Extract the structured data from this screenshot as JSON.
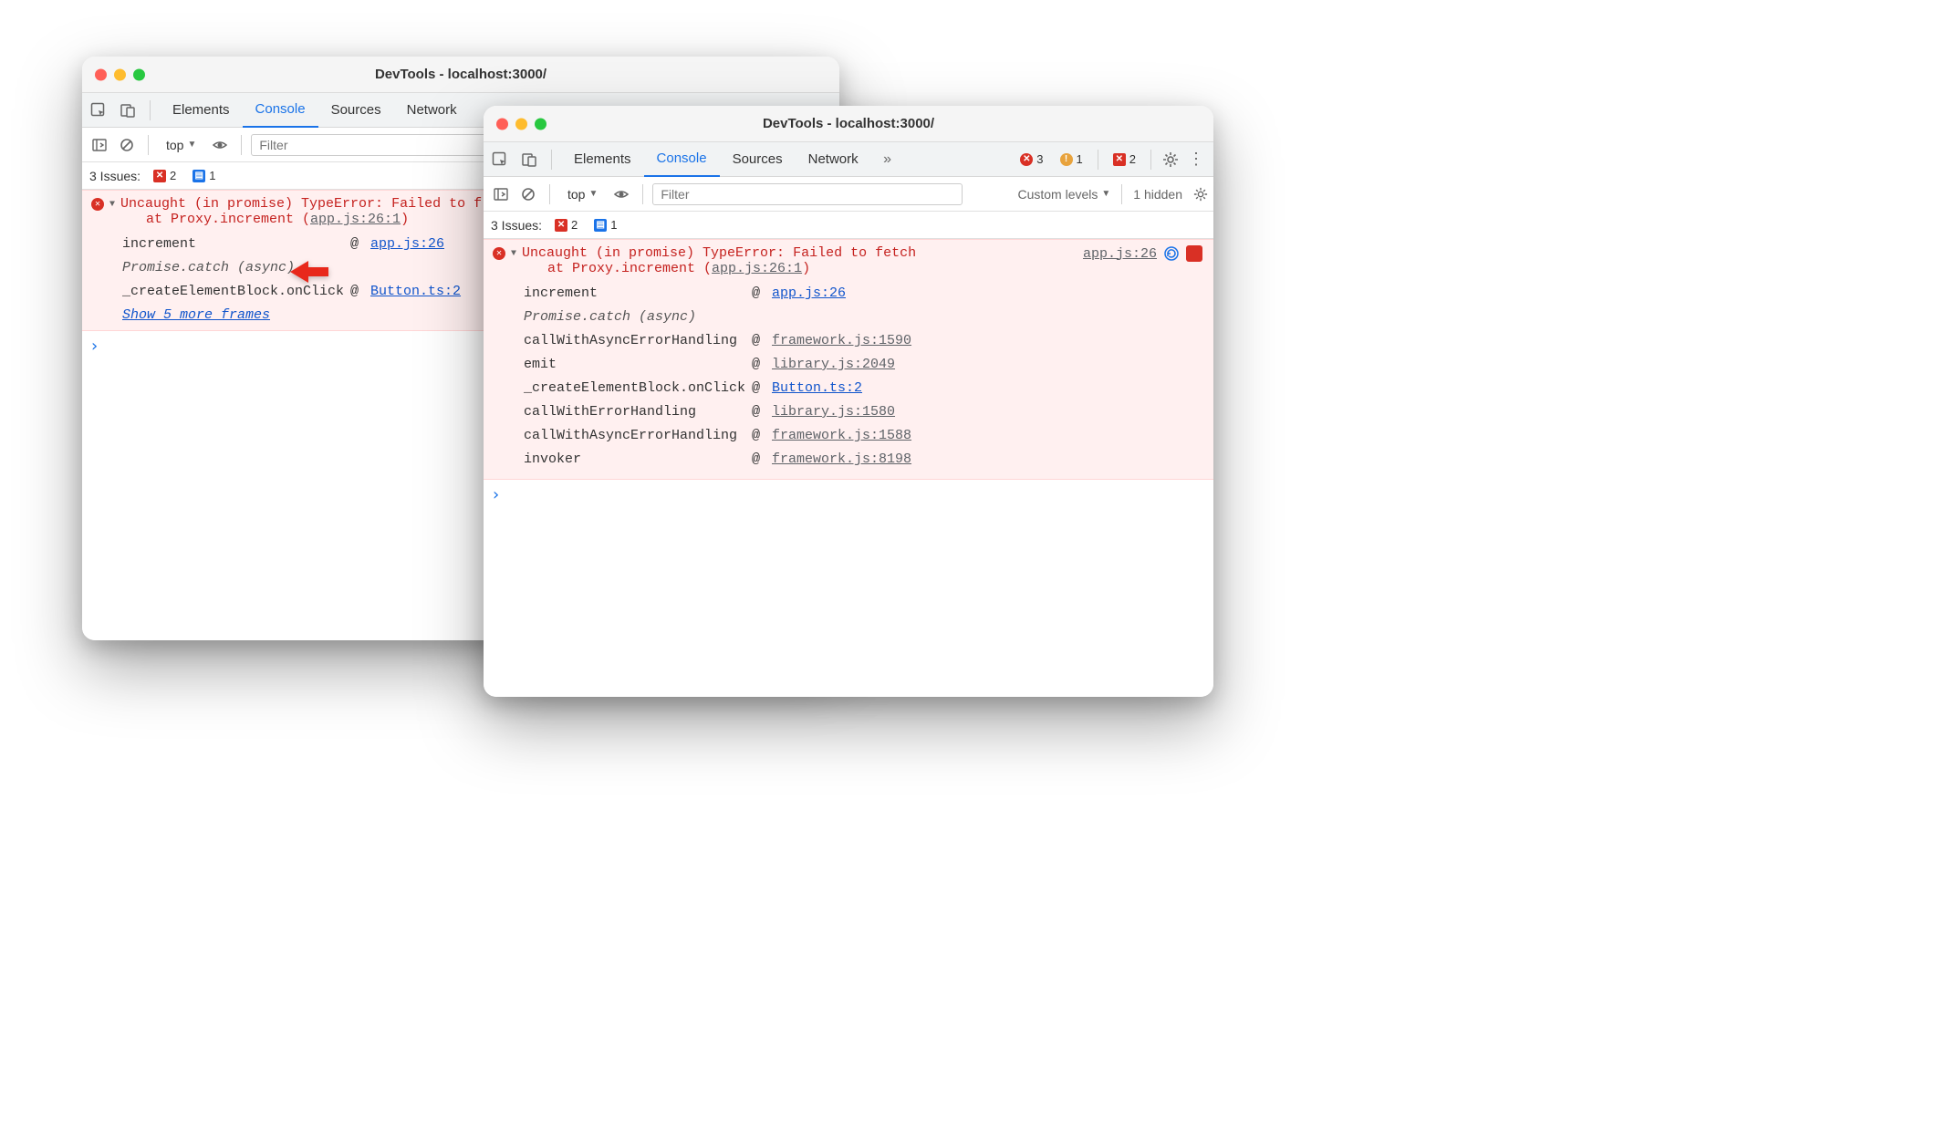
{
  "win1": {
    "title": "DevTools - localhost:3000/",
    "tabs": {
      "elements": "Elements",
      "console": "Console",
      "sources": "Sources",
      "network": "Network"
    },
    "subbar": {
      "context": "top",
      "filter_placeholder": "Filter"
    },
    "issues": {
      "label": "3 Issues:",
      "errors": "2",
      "msgs": "1"
    },
    "error": {
      "head1": "Uncaught (in promise) TypeError: Failed to f",
      "head2_prefix": "at Proxy.increment (",
      "head2_link": "app.js:26:1",
      "head2_suffix": ")",
      "stack": {
        "r0_fn": "increment",
        "r0_src": "app.js:26",
        "async": "Promise.catch (async)",
        "r2_fn": "_createElementBlock.onClick",
        "r2_src": "Button.ts:2"
      },
      "show_more": "Show 5 more frames"
    }
  },
  "win2": {
    "title": "DevTools - localhost:3000/",
    "tabs": {
      "elements": "Elements",
      "console": "Console",
      "sources": "Sources",
      "network": "Network"
    },
    "badges": {
      "errors": "3",
      "warnings": "1",
      "msgs": "2"
    },
    "subbar": {
      "context": "top",
      "filter_placeholder": "Filter",
      "levels": "Custom levels",
      "hidden": "1 hidden"
    },
    "issues": {
      "label": "3 Issues:",
      "errors": "2",
      "msgs": "1"
    },
    "error": {
      "head1": "Uncaught (in promise) TypeError: Failed to fetch",
      "head2_prefix": "at Proxy.increment (",
      "head2_link": "app.js:26:1",
      "head2_suffix": ")",
      "top_src": "app.js:26",
      "stack": {
        "r0_fn": "increment",
        "r0_src": "app.js:26",
        "async": "Promise.catch (async)",
        "r1_fn": "callWithAsyncErrorHandling",
        "r1_src": "framework.js:1590",
        "r2_fn": "emit",
        "r2_src": "library.js:2049",
        "r3_fn": "_createElementBlock.onClick",
        "r3_src": "Button.ts:2",
        "r4_fn": "callWithErrorHandling",
        "r4_src": "library.js:1580",
        "r5_fn": "callWithAsyncErrorHandling",
        "r5_src": "framework.js:1588",
        "r6_fn": "invoker",
        "r6_src": "framework.js:8198"
      }
    }
  }
}
